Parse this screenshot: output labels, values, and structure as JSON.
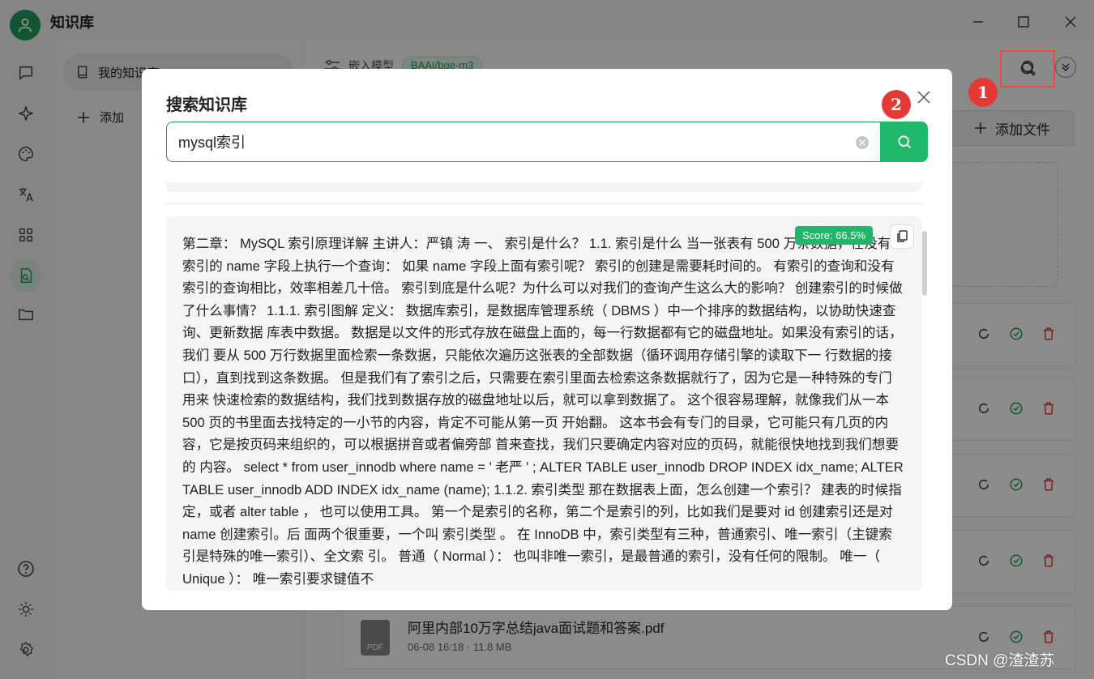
{
  "app": {
    "title": "知识库"
  },
  "window": {
    "minimize": "—",
    "maximize": "☐",
    "close": "✕"
  },
  "sidebar": {
    "icons": [
      "chat-icon",
      "sparkle-icon",
      "palette-icon",
      "translate-icon",
      "apps-icon",
      "knowledge-icon",
      "folder-icon"
    ],
    "bottom_icons": [
      "help-icon",
      "theme-icon",
      "settings-icon"
    ]
  },
  "kb_list": {
    "item_label": "我的知识库",
    "add_label": "添加"
  },
  "content": {
    "embed_label": "嵌入模型",
    "model_tag": "BAAI/bge-m3",
    "add_file_label": "添加文件",
    "files": [
      {
        "name": "阿里内部10万字总结java面试题和答案.pdf",
        "meta": "06-08 16:18 · 11.8 MB"
      }
    ]
  },
  "callouts": {
    "first": "1",
    "second": "2"
  },
  "modal": {
    "title": "搜索知识库",
    "query": "mysql索引",
    "result": {
      "score": "Score: 66.5%",
      "text": "第二章： MySQL 索引原理详解 主讲人：严镇 涛 一、 索引是什么？ 1.1. 索引是什么 当一张表有 500 万条数据，在没有索引的 name 字段上执行一个查询： 如果 name 字段上面有索引呢？ 索引的创建是需要耗时间的。 有索引的查询和没有索引的查询相比，效率相差几十倍。 索引到底是什么呢？为什么可以对我们的查询产生这么大的影响？ 创建索引的时候做了什么事情？ 1.1.1. 索引图解 定义： 数据库索引，是数据库管理系统（ DBMS ）中一个排序的数据结构，以协助快速查询、更新数据 库表中数据。 数据是以文件的形式存放在磁盘上面的，每一行数据都有它的磁盘地址。如果没有索引的话，我们 要从 500 万行数据里面检索一条数据，只能依次遍历这张表的全部数据（循环调用存储引擎的读取下一 行数据的接口），直到找到这条数据。 但是我们有了索引之后，只需要在索引里面去检索这条数据就行了，因为它是一种特殊的专门用来 快速检索的数据结构，我们找到数据存放的磁盘地址以后，就可以拿到数据了。 这个很容易理解，就像我们从一本 500 页的书里面去找特定的一小节的内容，肯定不可能从第一页 开始翻。 这本书会有专门的目录，它可能只有几页的内容，它是按页码来组织的，可以根据拼音或者偏旁部 首来查找，我们只要确定内容对应的页码，就能很快地找到我们想要的 内容。 select * from user_innodb where name = ' 老严 ' ; ALTER TABLE user_innodb DROP INDEX idx_name; ALTER TABLE user_innodb ADD INDEX idx_name (name); 1.1.2. 索引类型 那在数据表上面，怎么创建一个索引？ 建表的时候指定，或者 alter table ， 也可以使用工具。 第一个是索引的名称，第二个是索引的列，比如我们是要对 id 创建索引还是对 name 创建索引。后 面两个很重要，一个叫 索引类型 。 在 InnoDB 中，索引类型有三种，普通索引、唯一索引（主键索引是特殊的唯一索引）、全文索 引。 普通（ Normal ）： 也叫非唯一索引，是最普通的索引，没有任何的限制。 唯一（ Unique ）： 唯一索引要求键值不"
    }
  },
  "watermark": "CSDN @渣渣苏",
  "colors": {
    "accent": "#1fb86a",
    "callout": "#e53935"
  }
}
